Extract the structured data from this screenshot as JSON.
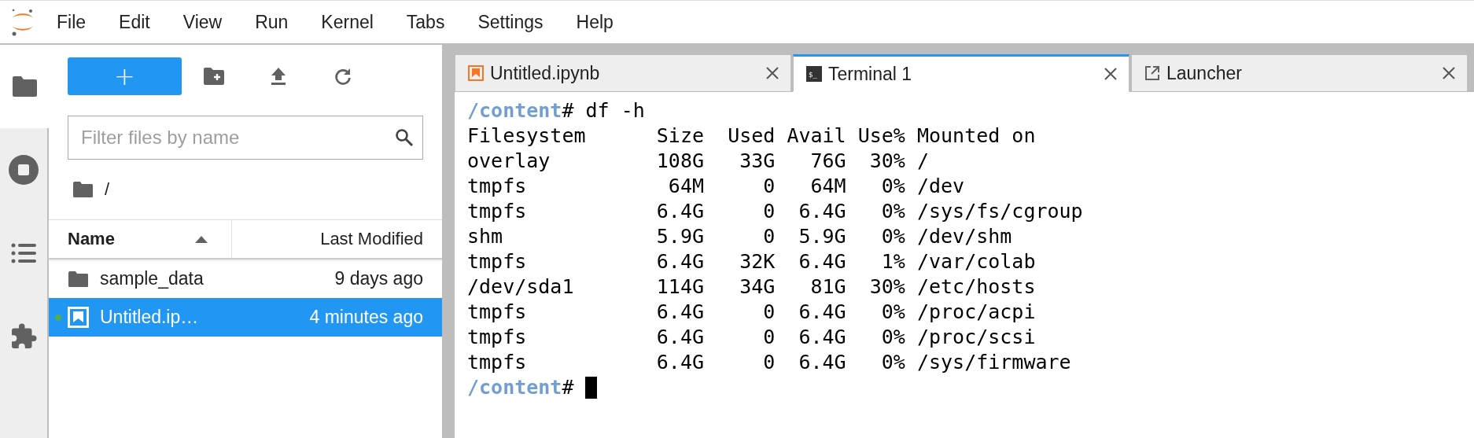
{
  "menu_bar": {
    "items": [
      "File",
      "Edit",
      "View",
      "Run",
      "Kernel",
      "Tabs",
      "Settings",
      "Help"
    ]
  },
  "left_sidebar": {
    "tabs": [
      {
        "kind": "folder",
        "selected": true
      },
      {
        "kind": "running",
        "selected": false
      },
      {
        "kind": "toc",
        "selected": false
      },
      {
        "kind": "extensions",
        "selected": false
      }
    ]
  },
  "file_browser": {
    "new_button": "+",
    "filter": {
      "placeholder": "Filter files by name"
    },
    "breadcrumb": "/",
    "columns": [
      {
        "label": "Name",
        "sorted": true
      },
      {
        "label": "Last Modified",
        "sorted": false
      }
    ],
    "rows": [
      {
        "kind": "folder",
        "name": "sample_data",
        "modified": "9 days ago",
        "selected": false,
        "running": false
      },
      {
        "kind": "notebook",
        "name": "Untitled.ip…",
        "modified": "4 minutes ago",
        "selected": true,
        "running": true
      }
    ]
  },
  "tabs": [
    {
      "kind": "notebook",
      "label": "Untitled.ipynb",
      "selected": false
    },
    {
      "kind": "terminal",
      "icon_text": "$_",
      "label": "Terminal 1",
      "selected": true
    },
    {
      "kind": "launcher",
      "label": "Launcher",
      "selected": false
    }
  ],
  "terminal": {
    "lines": [
      {
        "kind": "prompt",
        "path": "/content",
        "text": "# df -h"
      },
      {
        "kind": "output",
        "text": "Filesystem      Size  Used Avail Use% Mounted on"
      },
      {
        "kind": "output",
        "text": "overlay         108G   33G   76G  30% /"
      },
      {
        "kind": "output",
        "text": "tmpfs            64M     0   64M   0% /dev"
      },
      {
        "kind": "output",
        "text": "tmpfs           6.4G     0  6.4G   0% /sys/fs/cgroup"
      },
      {
        "kind": "output",
        "text": "shm             5.9G     0  5.9G   0% /dev/shm"
      },
      {
        "kind": "output",
        "text": "tmpfs           6.4G   32K  6.4G   1% /var/colab"
      },
      {
        "kind": "output",
        "text": "/dev/sda1       114G   34G   81G  30% /etc/hosts"
      },
      {
        "kind": "output",
        "text": "tmpfs           6.4G     0  6.4G   0% /proc/acpi"
      },
      {
        "kind": "output",
        "text": "tmpfs           6.4G     0  6.4G   0% /proc/scsi"
      },
      {
        "kind": "output",
        "text": "tmpfs           6.4G     0  6.4G   0% /sys/firmware"
      },
      {
        "kind": "prompt",
        "path": "/content",
        "text": "#",
        "cursor": true
      }
    ]
  }
}
